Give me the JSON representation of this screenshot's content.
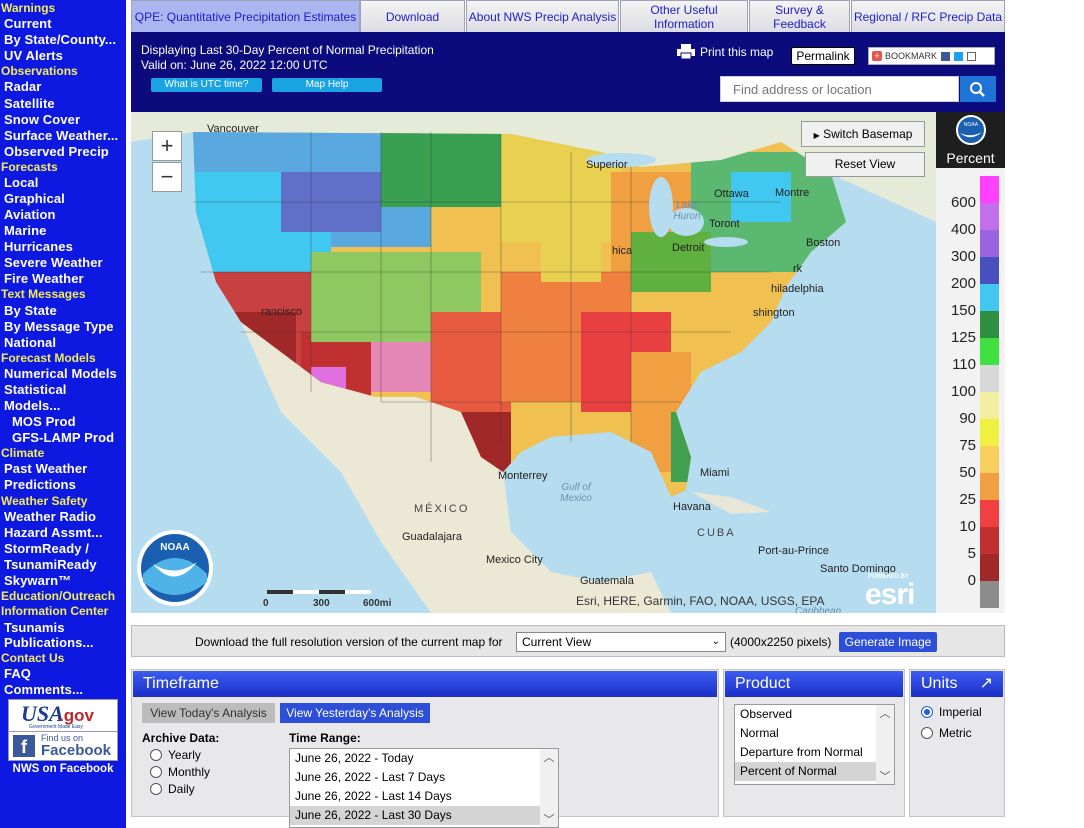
{
  "sidebar": [
    {
      "type": "section",
      "label": "Warnings"
    },
    {
      "type": "link",
      "label": "Current"
    },
    {
      "type": "link",
      "label": "By State/County..."
    },
    {
      "type": "link",
      "label": "UV Alerts"
    },
    {
      "type": "section",
      "label": "Observations"
    },
    {
      "type": "link",
      "label": "Radar"
    },
    {
      "type": "link",
      "label": "Satellite"
    },
    {
      "type": "link",
      "label": "Snow Cover"
    },
    {
      "type": "link",
      "label": "Surface Weather..."
    },
    {
      "type": "link",
      "label": "Observed Precip"
    },
    {
      "type": "section",
      "label": "Forecasts"
    },
    {
      "type": "link",
      "label": "Local"
    },
    {
      "type": "link",
      "label": "Graphical"
    },
    {
      "type": "link",
      "label": "Aviation"
    },
    {
      "type": "link",
      "label": "Marine"
    },
    {
      "type": "link",
      "label": "Hurricanes"
    },
    {
      "type": "link",
      "label": "Severe Weather"
    },
    {
      "type": "link",
      "label": "Fire Weather"
    },
    {
      "type": "section",
      "label": "Text Messages"
    },
    {
      "type": "link",
      "label": "By State"
    },
    {
      "type": "link",
      "label": "By Message Type"
    },
    {
      "type": "link",
      "label": "National"
    },
    {
      "type": "section",
      "label": "Forecast Models"
    },
    {
      "type": "link",
      "label": "Numerical Models"
    },
    {
      "type": "link",
      "label": "Statistical"
    },
    {
      "type": "link",
      "label": "Models..."
    },
    {
      "type": "sublink",
      "label": "MOS Prod"
    },
    {
      "type": "sublink",
      "label": "GFS-LAMP Prod"
    },
    {
      "type": "section",
      "label": "Climate"
    },
    {
      "type": "link",
      "label": "Past Weather"
    },
    {
      "type": "link",
      "label": "Predictions"
    },
    {
      "type": "section",
      "label": "Weather Safety"
    },
    {
      "type": "link",
      "label": "Weather Radio"
    },
    {
      "type": "link",
      "label": "Hazard Assmt..."
    },
    {
      "type": "link",
      "label": "StormReady /"
    },
    {
      "type": "link",
      "label": "TsunamiReady"
    },
    {
      "type": "link",
      "label": "Skywarn™"
    },
    {
      "type": "section",
      "label": "Education/Outreach"
    },
    {
      "type": "section",
      "label": "Information Center"
    },
    {
      "type": "link",
      "label": "Tsunamis"
    },
    {
      "type": "link",
      "label": "Publications..."
    },
    {
      "type": "section",
      "label": "Contact Us"
    },
    {
      "type": "link",
      "label": "FAQ"
    },
    {
      "type": "link",
      "label": "Comments..."
    }
  ],
  "badges": {
    "usagov_main": "USA",
    "usagov_suffix": ".gov",
    "usagov_tagline": "Government Made Easy",
    "facebook_find": "Find us on",
    "facebook_name": "Facebook",
    "facebook_caption": "NWS on Facebook"
  },
  "tabs": [
    {
      "label": "QPE: Quantitative Precipitation Estimates",
      "active": true
    },
    {
      "label": "Download",
      "active": false
    },
    {
      "label": "About NWS Precip Analysis",
      "active": false
    },
    {
      "label": "Other Useful Information",
      "active": false
    },
    {
      "label": "Survey & Feedback",
      "active": false
    },
    {
      "label": "Regional / RFC Precip Data",
      "active": false
    }
  ],
  "header": {
    "title": "Displaying Last 30-Day Percent of Normal Precipitation",
    "valid": "Valid on: June 26, 2022 12:00 UTC",
    "utc_button": "What is UTC time?",
    "help_button": "Map Help",
    "print": "Print this map",
    "permalink": "Permalink",
    "bookmark": "BOOKMARK",
    "search_placeholder": "Find address or location"
  },
  "map": {
    "zoom_in": "+",
    "zoom_out": "−",
    "switch_basemap": "Switch Basemap",
    "reset_view": "Reset View",
    "places": [
      {
        "name": "Vancouver"
      },
      {
        "name": "Superior"
      },
      {
        "name": "Ottawa"
      },
      {
        "name": "Montre"
      },
      {
        "name": "Toront"
      },
      {
        "name": "Boston"
      },
      {
        "name": "Detroit"
      },
      {
        "name": "hica"
      },
      {
        "name": "rk"
      },
      {
        "name": "hiladelphia"
      },
      {
        "name": "shington"
      },
      {
        "name": "rancisco"
      },
      {
        "name": "Miami"
      },
      {
        "name": "Monterrey"
      },
      {
        "name": "Havana"
      },
      {
        "name": "Guadalajara"
      },
      {
        "name": "Mexico City"
      },
      {
        "name": "Port-au-Prince"
      },
      {
        "name": "Santo Domingo"
      },
      {
        "name": "Guatemala"
      }
    ],
    "water_labels": [
      "Lake Huron",
      "Gulf of Mexico",
      "Caribbean Sea"
    ],
    "countries": [
      "MÉXICO",
      "CUBA"
    ],
    "scale_labels": [
      "0",
      "300",
      "600mi"
    ],
    "attribution": "Esri, HERE, Garmin, FAO, NOAA, USGS, EPA",
    "esri_logo": "esri",
    "powered_by": "POWERED BY",
    "noaa_logo_text": "NOAA",
    "help": "?"
  },
  "legend": {
    "title": "Percent",
    "noaa": "NOAA",
    "labels": [
      "600",
      "400",
      "300",
      "200",
      "150",
      "125",
      "110",
      "100",
      "90",
      "75",
      "50",
      "25",
      "10",
      "5",
      "0"
    ],
    "colors": [
      "#ff40ff",
      "#c070e8",
      "#9a63e0",
      "#4850c0",
      "#40c8f0",
      "#2f8f40",
      "#40e040",
      "#d8d8d8",
      "#f0f0a0",
      "#f0f040",
      "#f8d060",
      "#f0a040",
      "#f04040",
      "#c03030",
      "#a02828",
      "#8c8c8c"
    ]
  },
  "download": {
    "text": "Download the full resolution version of the current map for",
    "select_value": "Current View",
    "pixels": "(4000x2250 pixels)",
    "button": "Generate Image"
  },
  "timeframe": {
    "title": "Timeframe",
    "today": "View Today's Analysis",
    "yesterday": "View Yesterday's Analysis",
    "archive_label": "Archive Data:",
    "archive_options": [
      "Yearly",
      "Monthly",
      "Daily"
    ],
    "range_label": "Time Range:",
    "range_options": [
      "June 26, 2022 - Today",
      "June 26, 2022 - Last 7 Days",
      "June 26, 2022 - Last 14 Days",
      "June 26, 2022 - Last 30 Days"
    ],
    "range_selected": 3
  },
  "product": {
    "title": "Product",
    "options": [
      "Observed",
      "Normal",
      "Departure from Normal",
      "Percent of Normal"
    ],
    "selected": 3
  },
  "units": {
    "title": "Units",
    "expand": "↗",
    "options": [
      "Imperial",
      "Metric"
    ],
    "selected": 0
  }
}
